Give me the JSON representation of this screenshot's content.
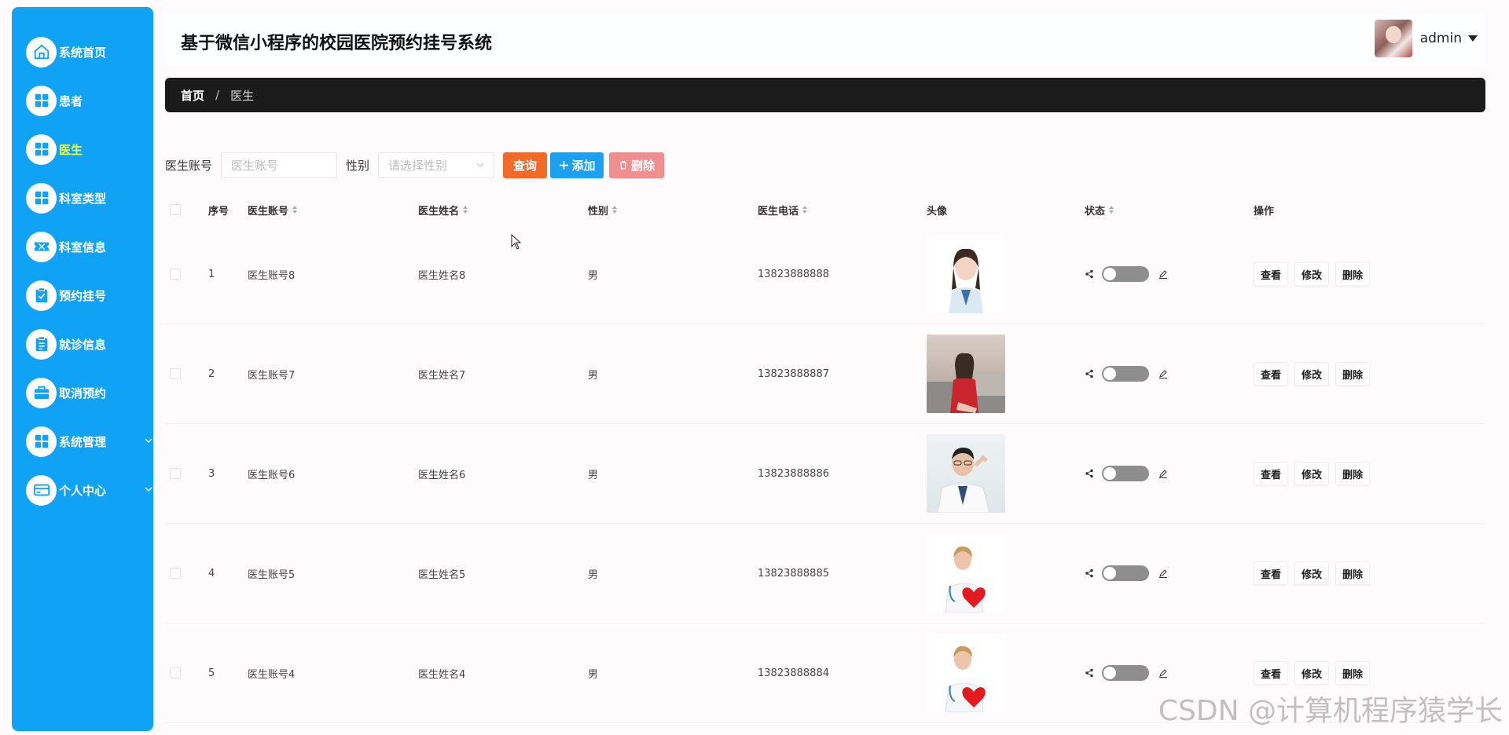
{
  "app": {
    "title": "基于微信小程序的校园医院预约挂号系统"
  },
  "user": {
    "name": "admin"
  },
  "sidebar": {
    "items": [
      {
        "label": "系统首页",
        "icon": "home-icon"
      },
      {
        "label": "患者",
        "icon": "grid-icon"
      },
      {
        "label": "医生",
        "icon": "grid-icon",
        "active": true
      },
      {
        "label": "科室类型",
        "icon": "grid-icon"
      },
      {
        "label": "科室信息",
        "icon": "ticket-icon"
      },
      {
        "label": "预约挂号",
        "icon": "clipboard-check-icon"
      },
      {
        "label": "就诊信息",
        "icon": "clipboard-icon"
      },
      {
        "label": "取消预约",
        "icon": "briefcase-icon"
      },
      {
        "label": "系统管理",
        "icon": "grid-icon",
        "expandable": true
      },
      {
        "label": "个人中心",
        "icon": "card-icon",
        "expandable": true
      }
    ]
  },
  "breadcrumb": {
    "home": "首页",
    "separator": "/",
    "current": "医生"
  },
  "search": {
    "account_label": "医生账号",
    "account_placeholder": "医生账号",
    "gender_label": "性别",
    "gender_placeholder": "请选择性别",
    "query_label": "查询",
    "add_label": "添加",
    "delete_label": "删除"
  },
  "table": {
    "headers": {
      "index": "序号",
      "account": "医生账号",
      "name": "医生姓名",
      "gender": "性别",
      "phone": "医生电话",
      "avatar": "头像",
      "status": "状态",
      "actions": "操作"
    },
    "actions": {
      "view": "查看",
      "edit": "修改",
      "delete": "删除"
    },
    "rows": [
      {
        "index": "1",
        "account": "医生账号8",
        "name": "医生姓名8",
        "gender": "男",
        "phone": "13823888888",
        "status_on": false
      },
      {
        "index": "2",
        "account": "医生账号7",
        "name": "医生姓名7",
        "gender": "男",
        "phone": "13823888887",
        "status_on": false
      },
      {
        "index": "3",
        "account": "医生账号6",
        "name": "医生姓名6",
        "gender": "男",
        "phone": "13823888886",
        "status_on": false
      },
      {
        "index": "4",
        "account": "医生账号5",
        "name": "医生姓名5",
        "gender": "男",
        "phone": "13823888885",
        "status_on": false
      },
      {
        "index": "5",
        "account": "医生账号4",
        "name": "医生姓名4",
        "gender": "男",
        "phone": "13823888884",
        "status_on": false
      }
    ]
  },
  "watermark": "CSDN @计算机程序猿学长",
  "colors": {
    "sidebar": "#10a3f5",
    "active_label": "#f7ff3a",
    "query": "#f26a2a",
    "add": "#1da0ef",
    "delete": "#ef8f8f",
    "breadcrumb_bg": "#1b1b1b"
  }
}
